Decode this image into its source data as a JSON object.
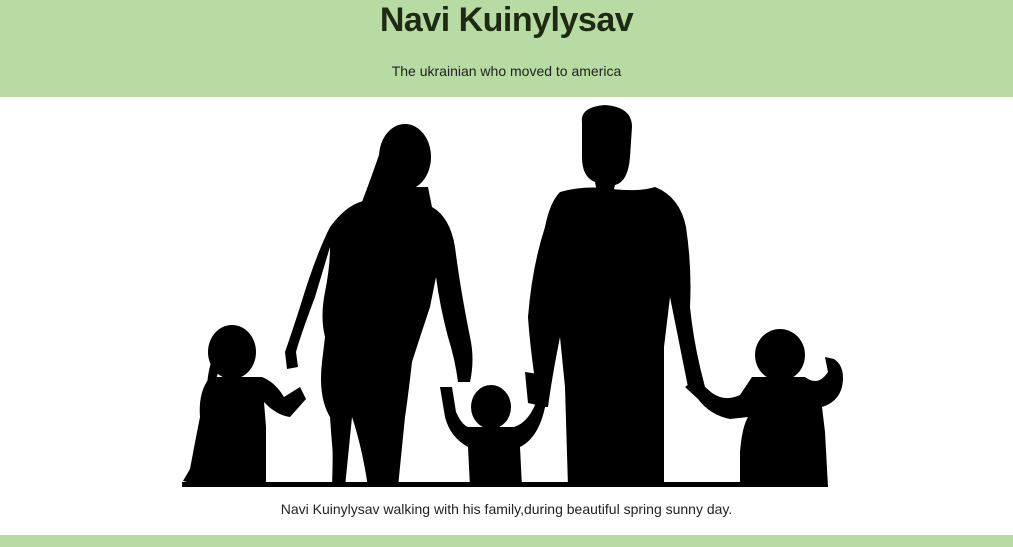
{
  "header": {
    "title": "Navi Kuinylysav",
    "subtitle": "The ukrainian who moved to america",
    "background_color": "#b8dba4"
  },
  "figure": {
    "image": "family-silhouette-image",
    "caption": "Navi Kuinylysav walking with his family,during beautiful spring sunny day."
  }
}
